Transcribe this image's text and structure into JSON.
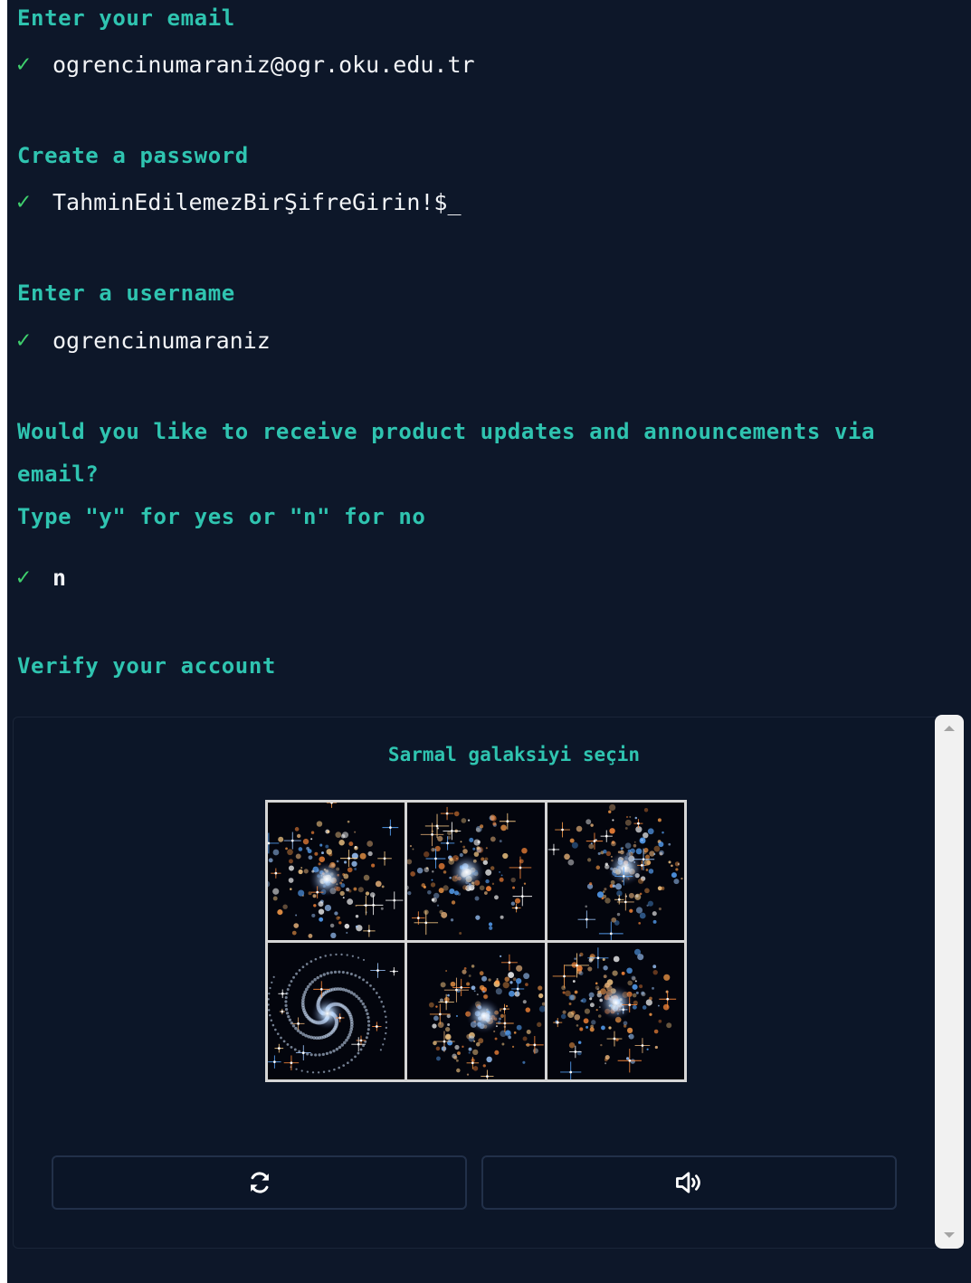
{
  "form": {
    "email": {
      "prompt": "Enter your email",
      "value": "ogrencinumaraniz@ogr.oku.edu.tr"
    },
    "password": {
      "prompt": "Create a password",
      "value": "TahminEdilemezBirŞifreGirin!$_"
    },
    "username": {
      "prompt": "Enter a username",
      "value": "ogrencinumaraniz"
    },
    "updates": {
      "prompt_line1": "Would you like to receive product updates and announcements via",
      "prompt_line2": "email?",
      "prompt_line3": "Type \"y\" for yes or \"n\" for no",
      "value": "n"
    },
    "verify": {
      "prompt": "Verify your account"
    },
    "check_glyph": "✓"
  },
  "captcha": {
    "instruction": "Sarmal galaksiyi seçin",
    "tiles": [
      {
        "kind": "irregular-galaxy"
      },
      {
        "kind": "irregular-galaxy"
      },
      {
        "kind": "irregular-galaxy"
      },
      {
        "kind": "spiral-galaxy"
      },
      {
        "kind": "irregular-galaxy"
      },
      {
        "kind": "irregular-galaxy"
      }
    ],
    "buttons": {
      "refresh_icon": "refresh-icon",
      "audio_icon": "speaker-icon"
    }
  },
  "colors": {
    "background": "#0d1729",
    "prompt": "#2fc4b0",
    "check": "#3fd06d",
    "answer": "#f2f4f7"
  }
}
